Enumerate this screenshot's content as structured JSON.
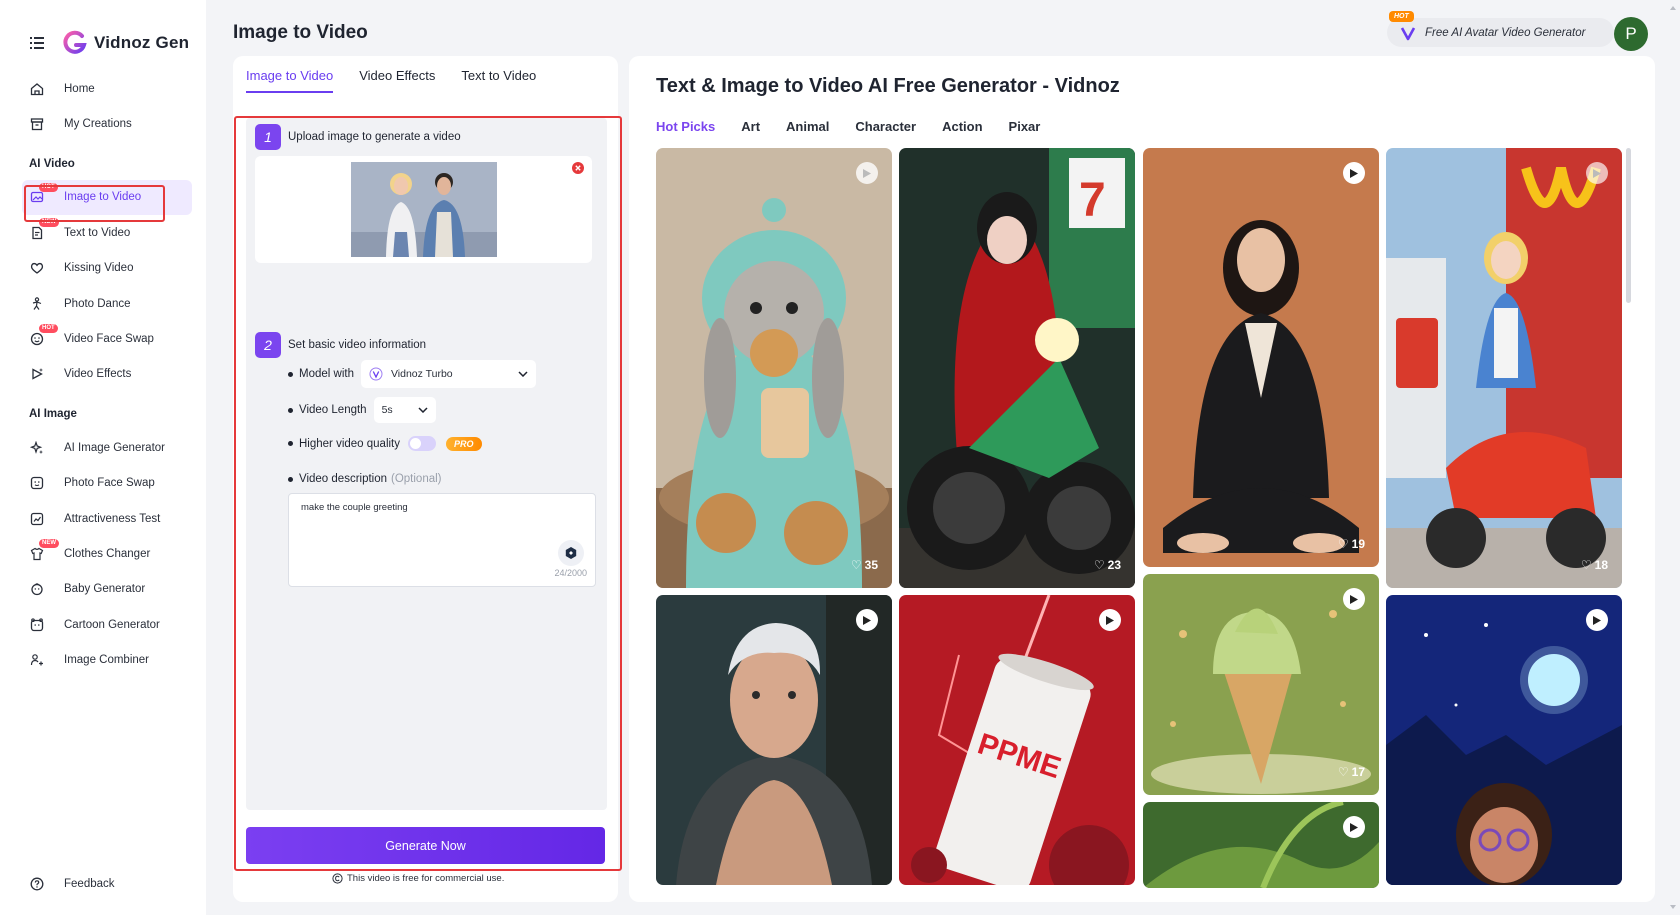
{
  "brand": {
    "name": "Vidnoz Gen"
  },
  "sidebar": {
    "items_top": [
      {
        "label": "Home",
        "icon": "home-icon"
      },
      {
        "label": "My Creations",
        "icon": "archive-icon"
      }
    ],
    "section_video": "AI Video",
    "video_items": [
      {
        "label": "Image to Video",
        "tag": "HOT",
        "icon": "image-video-icon"
      },
      {
        "label": "Text to Video",
        "tag": "NEW",
        "icon": "document-icon"
      },
      {
        "label": "Kissing Video",
        "tag": "",
        "icon": "heart-icon"
      },
      {
        "label": "Photo Dance",
        "tag": "",
        "icon": "dance-icon"
      },
      {
        "label": "Video Face Swap",
        "tag": "HOT",
        "icon": "face-swap-icon"
      },
      {
        "label": "Video Effects",
        "tag": "",
        "icon": "effects-icon"
      }
    ],
    "section_image": "AI Image",
    "image_items": [
      {
        "label": "AI Image Generator",
        "tag": "",
        "icon": "sparkle-icon"
      },
      {
        "label": "Photo Face Swap",
        "tag": "",
        "icon": "face-icon"
      },
      {
        "label": "Attractiveness Test",
        "tag": "",
        "icon": "score-icon"
      },
      {
        "label": "Clothes Changer",
        "tag": "NEW",
        "icon": "shirt-icon"
      },
      {
        "label": "Baby Generator",
        "tag": "",
        "icon": "baby-icon"
      },
      {
        "label": "Cartoon Generator",
        "tag": "",
        "icon": "cartoon-icon"
      },
      {
        "label": "Image Combiner",
        "tag": "",
        "icon": "combine-icon"
      }
    ],
    "feedback": "Feedback"
  },
  "header": {
    "title": "Image to Video",
    "promo_hot": "HOT",
    "promo_text": "Free AI Avatar Video Generator",
    "avatar_letter": "P"
  },
  "panel": {
    "tabs": [
      "Image to Video",
      "Video Effects",
      "Text to Video"
    ],
    "step1_num": "1",
    "step1_label": "Upload image to generate a video",
    "step2_num": "2",
    "step2_label": "Set basic video information",
    "model_label": "Model with",
    "model_value": "Vidnoz Turbo",
    "length_label": "Video Length",
    "length_value": "5s",
    "quality_label": "Higher video quality",
    "quality_on": false,
    "pro_badge": "PRO",
    "desc_label": "Video description",
    "desc_optional": "(Optional)",
    "desc_value": "make the couple greeting",
    "desc_counter": "24/2000",
    "generate_label": "Generate Now",
    "commercial_note": "This video is free for commercial use."
  },
  "gallery": {
    "title": "Text & Image to Video AI Free Generator - Vidnoz",
    "categories": [
      "Hot Picks",
      "Art",
      "Animal",
      "Character",
      "Action",
      "Pixar"
    ],
    "active_category": "Hot Picks",
    "cards": [
      {
        "name": "bunny-cookie",
        "likes": "35",
        "play": true
      },
      {
        "name": "red-hood-motorcycle",
        "likes": "23",
        "play": false
      },
      {
        "name": "woman-sitting",
        "likes": "19",
        "play": true
      },
      {
        "name": "alice-scooter",
        "likes": "18",
        "play": true
      },
      {
        "name": "silver-hair-man",
        "likes": "",
        "play": true
      },
      {
        "name": "ppme-can",
        "likes": "",
        "play": true
      },
      {
        "name": "ice-cream-cone",
        "likes": "17",
        "play": true
      },
      {
        "name": "night-girl-moon",
        "likes": "",
        "play": true
      },
      {
        "name": "green-leaf-fish",
        "likes": "",
        "play": true
      }
    ],
    "can_text": "PPME"
  },
  "colors": {
    "accent": "#7b45ef",
    "highlight": "#e5393b",
    "avatar": "#2d6a2f"
  }
}
